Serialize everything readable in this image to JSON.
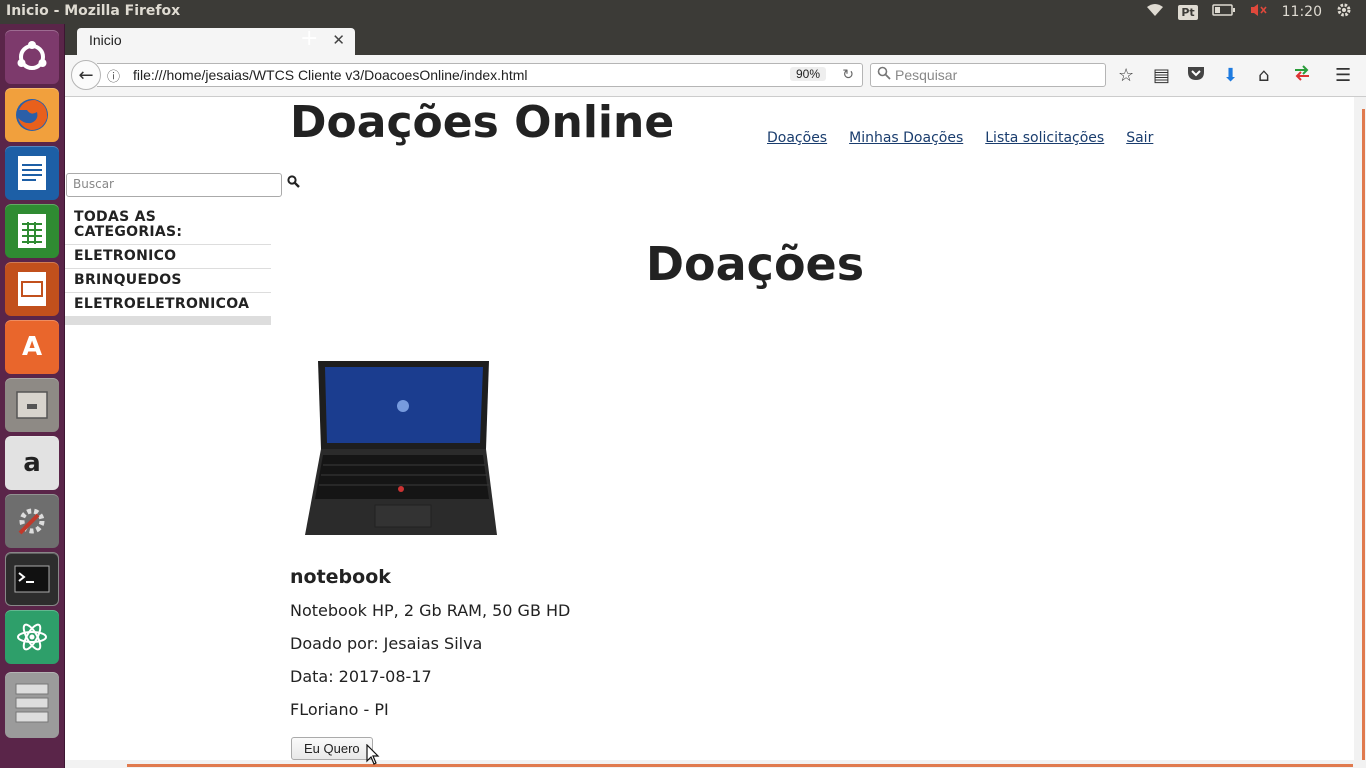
{
  "panel": {
    "window_title": "Inicio - Mozilla Firefox",
    "keyboard_layout": "Pt",
    "clock": "11:20",
    "icons": [
      "wifi-icon",
      "battery-icon",
      "volume-muted-icon",
      "power-gear-icon"
    ]
  },
  "launcher": {
    "items": [
      "ubuntu-dash",
      "firefox",
      "libreoffice-writer",
      "libreoffice-calc",
      "libreoffice-impress",
      "ubuntu-software",
      "files",
      "amazon",
      "system-settings",
      "terminal",
      "atom",
      "disk"
    ]
  },
  "browser": {
    "tab_title": "Inicio",
    "url": "file:///home/jesaias/WTCS Cliente v3/DoacoesOnline/index.html",
    "zoom": "90%",
    "search_placeholder": "Pesquisar"
  },
  "page": {
    "site_title": "Doações Online",
    "nav": [
      "Doações",
      "Minhas Doações",
      "Lista solicitações",
      "Sair"
    ],
    "search_placeholder": "Buscar",
    "categories_header": "TODAS AS CATEGORIAS:",
    "categories": [
      "ELETRONICO",
      "BRINQUEDOS",
      "ELETROELETRONICOA"
    ],
    "heading": "Doações",
    "product": {
      "title": "notebook",
      "description": "Notebook HP, 2 Gb RAM, 50 GB HD",
      "donor": "Doado por: Jesaias Silva",
      "date": "Data: 2017-08-17",
      "location": "FLoriano - PI",
      "button": "Eu Quero"
    }
  }
}
